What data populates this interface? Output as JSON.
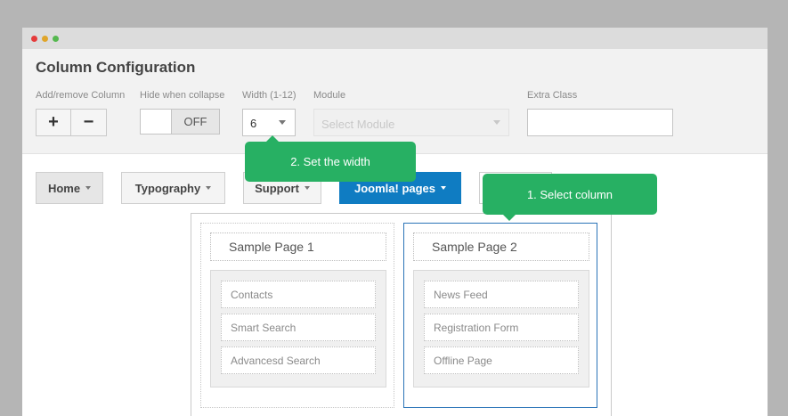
{
  "panel": {
    "title": "Column Configuration",
    "labels": {
      "add_remove": "Add/remove Column",
      "hide_collapse": "Hide when collapse",
      "width": "Width (1-12)",
      "module": "Module",
      "extra_class": "Extra Class"
    },
    "add_label": "+",
    "remove_label": "−",
    "toggle_state": "OFF",
    "width_value": "6",
    "module_placeholder": "Select Module",
    "extra_class_value": ""
  },
  "menu": {
    "items": [
      {
        "label": "Home"
      },
      {
        "label": "Typography"
      },
      {
        "label": "Support"
      },
      {
        "label": "Joomla! pages"
      }
    ]
  },
  "columns": [
    {
      "title": "Sample Page 1",
      "items": [
        "Contacts",
        "Smart Search",
        "Advancesd Search"
      ]
    },
    {
      "title": "Sample Page 2",
      "items": [
        "News Feed",
        "Registration Form",
        "Offline Page"
      ]
    }
  ],
  "tooltips": {
    "width": "2. Set the width",
    "column": "1. Select column"
  },
  "colors": {
    "accent_blue": "#0f7cc2",
    "tooltip_green": "#27b063",
    "selected_border": "#2b74b8"
  }
}
